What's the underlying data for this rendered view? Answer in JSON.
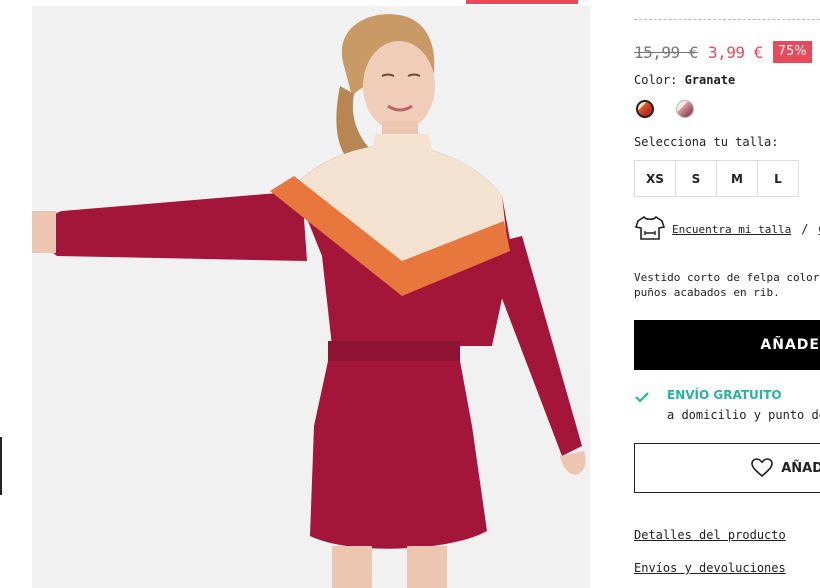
{
  "product": {
    "image_alt": "Model wearing a burgundy sweatshirt dress with cream and orange chevron yoke",
    "old_price": "15,99 €",
    "new_price": "3,99 €",
    "discount": "75%",
    "color_label": "Color:",
    "color_value": "Granate",
    "swatches": [
      "granate",
      "rosa"
    ],
    "size_label": "Selecciona tu talla:",
    "sizes": [
      "XS",
      "S",
      "M",
      "L"
    ],
    "size_finder_link": "Encuentra mi talla",
    "separator": "/",
    "size_guide_link": "Gu",
    "description_line1": "Vestido corto de felpa color bloc",
    "description_line2": "puños acabados en rib.",
    "add_button": "AÑADE",
    "shipping_title": "ENVÍO GRATUITO",
    "shipping_sub": "a domicilio y punto de rec",
    "wishlist_button": "AÑAD",
    "details_link": "Detalles del producto",
    "returns_link": "Envíos y devoluciones"
  },
  "colors": {
    "accent": "#e8495b",
    "shipping_green": "#27b39e",
    "dress": "#a3163a",
    "yoke": "#f3e2cf",
    "stripe": "#e8773d"
  }
}
